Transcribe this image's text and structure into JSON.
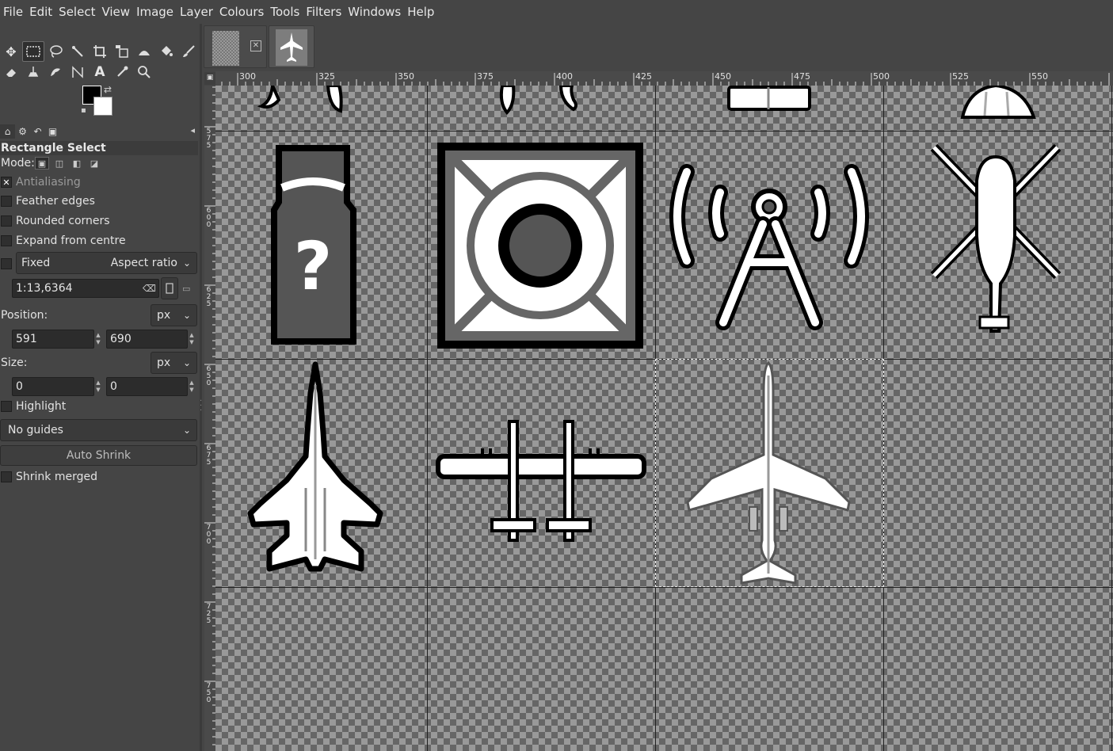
{
  "menubar": {
    "items": [
      "File",
      "Edit",
      "Select",
      "View",
      "Image",
      "Layer",
      "Colours",
      "Tools",
      "Filters",
      "Windows",
      "Help"
    ]
  },
  "toolbox": {
    "row1_icons": [
      "move-icon",
      "rect-select-icon",
      "lasso-icon",
      "fuzzy-select-icon",
      "crop-icon",
      "transform-icon",
      "warp-icon",
      "bucket-fill-icon",
      "paintbrush-icon"
    ],
    "row2_icons": [
      "eraser-icon",
      "clone-icon",
      "smudge-icon",
      "paths-icon",
      "text-icon",
      "color-picker-icon",
      "zoom-icon"
    ],
    "fg_color": "#000000",
    "bg_color": "#ffffff"
  },
  "tool_options": {
    "title": "Rectangle Select",
    "mode_label": "Mode:",
    "antialiasing": {
      "label": "Antialiasing",
      "checked": true
    },
    "feather_edges": {
      "label": "Feather edges",
      "checked": false
    },
    "rounded_corners": {
      "label": "Rounded corners",
      "checked": false
    },
    "expand_from_centre": {
      "label": "Expand from centre",
      "checked": false
    },
    "fixed": {
      "label": "Fixed",
      "checked": false,
      "dropdown": "Aspect ratio"
    },
    "ratio_value": "1:13,6364",
    "position": {
      "label": "Position:",
      "unit": "px",
      "x": "591",
      "y": "690"
    },
    "size": {
      "label": "Size:",
      "unit": "px",
      "w": "0",
      "h": "0"
    },
    "highlight": {
      "label": "Highlight",
      "checked": false
    },
    "guides": "No guides",
    "auto_shrink": "Auto Shrink",
    "shrink_merged": {
      "label": "Shrink merged",
      "checked": false
    }
  },
  "rulers": {
    "horizontal": [
      "300",
      "325",
      "350",
      "375",
      "400",
      "425",
      "450",
      "475",
      "500",
      "525",
      "550"
    ],
    "vertical": [
      "575",
      "600",
      "625",
      "650",
      "675",
      "700",
      "725",
      "750"
    ]
  },
  "colors": {
    "panel_bg": "#454545",
    "checker_light": "#999999",
    "checker_dark": "#666666",
    "grid_line": "#222222"
  }
}
